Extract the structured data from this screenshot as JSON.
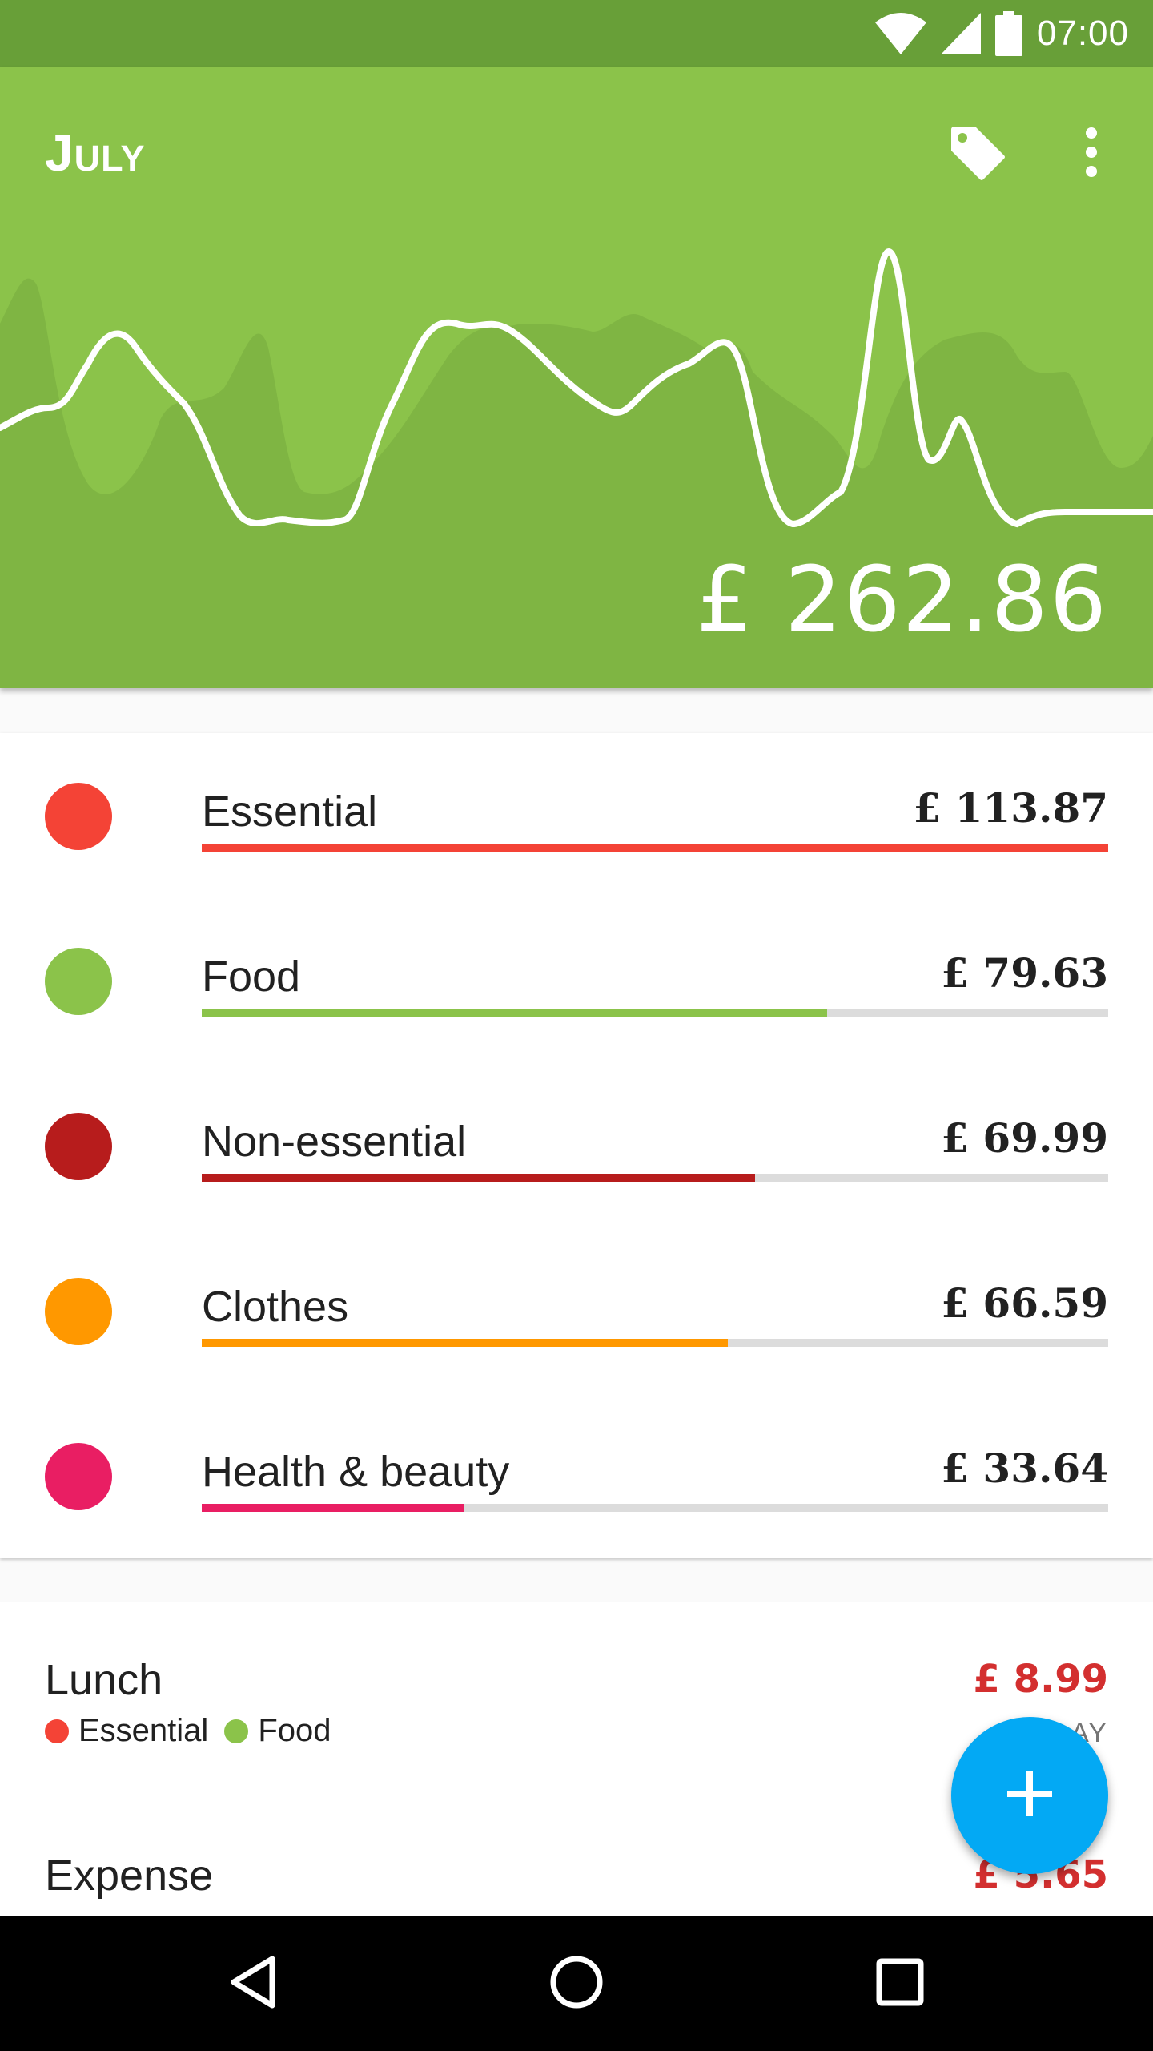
{
  "status_bar": {
    "time": "07:00",
    "icons": [
      "wifi-icon",
      "signal-icon",
      "battery-icon"
    ]
  },
  "header": {
    "title": "July",
    "total": "£ 262.86",
    "actions": [
      "tag-icon",
      "more-vert-icon"
    ],
    "background_color": "#8bc34a"
  },
  "categories": [
    {
      "name": "Essential",
      "amount": "£ 113.87",
      "color": "#f44336",
      "fraction": 1.0
    },
    {
      "name": "Food",
      "amount": "£ 79.63",
      "color": "#8bc34a",
      "fraction": 0.69
    },
    {
      "name": "Non-essential",
      "amount": "£ 69.99",
      "color": "#b71c1c",
      "fraction": 0.61
    },
    {
      "name": "Clothes",
      "amount": "£ 66.59",
      "color": "#ff9800",
      "fraction": 0.58
    },
    {
      "name": "Health & beauty",
      "amount": "£ 33.64",
      "color": "#e91e63",
      "fraction": 0.29
    }
  ],
  "transactions": [
    {
      "title": "Lunch",
      "amount": "£ 8.99",
      "date_partial": "AY",
      "tags": [
        {
          "name": "Essential",
          "color": "#f44336"
        },
        {
          "name": "Food",
          "color": "#8bc34a"
        }
      ]
    },
    {
      "title": "Expense",
      "amount": "£ 5.65"
    }
  ],
  "fab": {
    "icon": "plus-icon",
    "color": "#03a9f4"
  },
  "nav": [
    "back-icon",
    "home-icon",
    "recents-icon"
  ]
}
